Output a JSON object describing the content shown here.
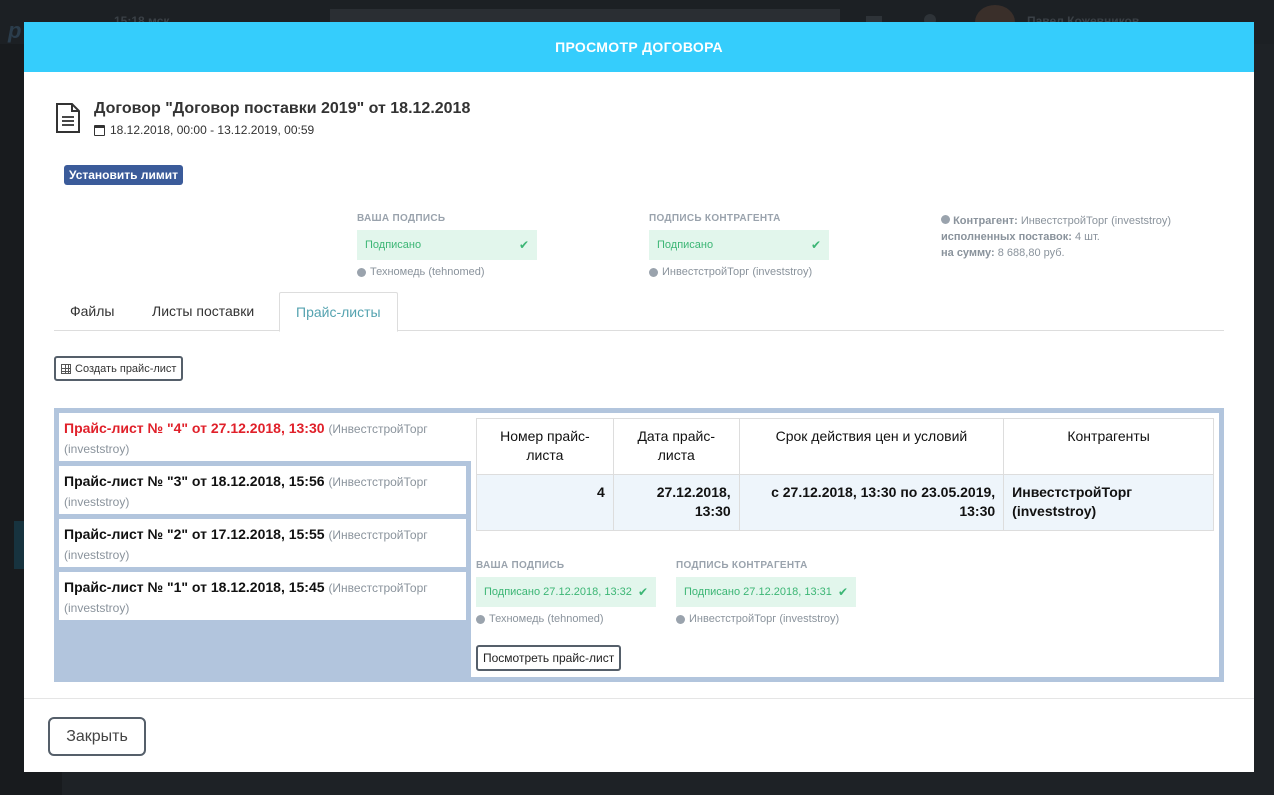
{
  "background": {
    "logo": "p",
    "time": "15:18 мск",
    "user_name": "Павел Кожевников"
  },
  "modal": {
    "title": "ПРОСМОТР ДОГОВОРА",
    "document": {
      "title": "Договор \"Договор поставки 2019\" от 18.12.2018",
      "dates": "18.12.2018, 00:00 - 13.12.2019, 00:59"
    },
    "set_limit_label": "Установить лимит",
    "my_signature": {
      "label": "ВАША ПОДПИСЬ",
      "status": "Подписано",
      "user": "Техномедь (tehnomed)"
    },
    "partner_signature": {
      "label": "ПОДПИСЬ КОНТРАГЕНТА",
      "status": "Подписано",
      "user": "ИнвестстройТорг (investstroy)"
    },
    "partner_info": {
      "partner_label": "Контрагент:",
      "partner_value": "ИнвестстройТорг (investstroy)",
      "deliveries_label": "исполненных поставок:",
      "deliveries_value": "4  шт.",
      "sum_label": "на сумму:",
      "sum_value": "8 688,80  руб."
    },
    "tabs": [
      {
        "label": "Файлы",
        "active": false
      },
      {
        "label": "Листы поставки",
        "active": false
      },
      {
        "label": "Прайс-листы",
        "active": true
      }
    ],
    "create_price_list_label": "Создать прайс-лист",
    "price_lists": [
      {
        "title": "Прайс-лист № \"4\" от 27.12.2018, 13:30",
        "owner": "(ИнвестстройТорг (investstroy)",
        "active": true
      },
      {
        "title": "Прайс-лист № \"3\" от 18.12.2018, 15:56",
        "owner": "(ИнвестстройТорг (investstroy)",
        "active": false
      },
      {
        "title": "Прайс-лист № \"2\" от 17.12.2018, 15:55",
        "owner": "(ИнвестстройТорг (investstroy)",
        "active": false
      },
      {
        "title": "Прайс-лист № \"1\" от 18.12.2018, 15:45",
        "owner": "(ИнвестстройТорг (investstroy)",
        "active": false
      }
    ],
    "detail": {
      "columns": [
        "Номер прайс-листа",
        "Дата прайс-листа",
        "Срок действия цен и условий",
        "Контрагенты"
      ],
      "row": {
        "number": "4",
        "date": "27.12.2018, 13:30",
        "term": "с 27.12.2018, 13:30 по 23.05.2019, 13:30",
        "partners": "ИнвестстройТорг (investstroy)"
      },
      "my_signature": {
        "label": "ВАША ПОДПИСЬ",
        "status": "Подписано 27.12.2018, 13:32",
        "user": "Техномедь (tehnomed)"
      },
      "partner_signature": {
        "label": "ПОДПИСЬ КОНТРАГЕНТА",
        "status": "Подписано 27.12.2018, 13:31",
        "user": "ИнвестстройТорг (investstroy)"
      },
      "view_label": "Посмотреть прайс-лист"
    },
    "close_label": "Закрыть"
  },
  "colors": {
    "header": "#35cdfc",
    "signed_bg": "#e2f6ec",
    "signed_text": "#3cb675",
    "active_item": "#e0202a",
    "panel_bg": "#b2c5dd",
    "limit_button": "#3b5b9a"
  }
}
